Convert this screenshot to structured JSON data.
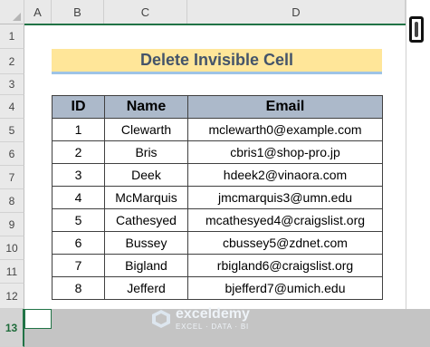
{
  "sheet": {
    "columns": [
      "A",
      "B",
      "C",
      "D"
    ],
    "rows": [
      "1",
      "2",
      "3",
      "4",
      "5",
      "6",
      "7",
      "8",
      "9",
      "10",
      "11",
      "12",
      "13"
    ],
    "selected_row": "13",
    "title": "Delete Invisible Cell",
    "headers": [
      "ID",
      "Name",
      "Email"
    ],
    "records": [
      {
        "id": "1",
        "name": "Clewarth",
        "email": "mclewarth0@example.com"
      },
      {
        "id": "2",
        "name": "Bris",
        "email": "cbris1@shop-pro.jp"
      },
      {
        "id": "3",
        "name": "Deek",
        "email": "hdeek2@vinaora.com"
      },
      {
        "id": "4",
        "name": "McMarquis",
        "email": "jmcmarquis3@umn.edu"
      },
      {
        "id": "5",
        "name": "Cathesyed",
        "email": "mcathesyed4@craigslist.org"
      },
      {
        "id": "6",
        "name": "Bussey",
        "email": "cbussey5@zdnet.com"
      },
      {
        "id": "7",
        "name": "Bigland",
        "email": "rbigland6@craigslist.org"
      },
      {
        "id": "8",
        "name": "Jefferd",
        "email": "bjefferd7@umich.edu"
      }
    ]
  },
  "watermark": {
    "name": "exceldemy",
    "tagline": "EXCEL · DATA · BI"
  },
  "colors": {
    "accent": "#217346",
    "title_fill": "#ffe699",
    "header_fill": "#acb9ca"
  }
}
